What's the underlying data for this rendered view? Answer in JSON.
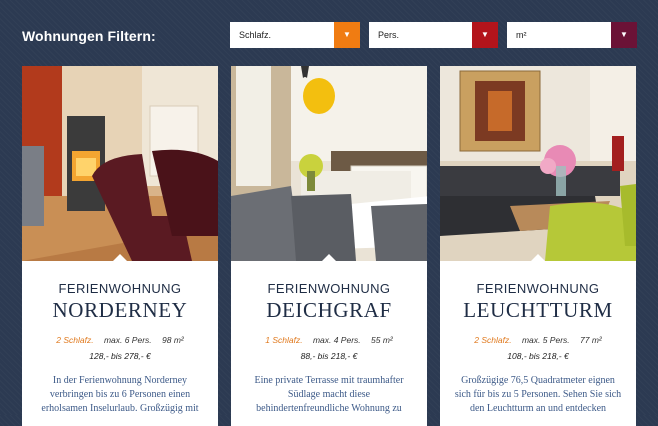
{
  "filter": {
    "title": "Wohnungen Filtern:",
    "selects": [
      {
        "label": "Schlafz.",
        "color": "#f07c12"
      },
      {
        "label": "Pers.",
        "color": "#b3141b"
      },
      {
        "label": "m²",
        "color": "#6b1236"
      }
    ],
    "arrow_icon": "chevron-down-icon"
  },
  "cards": [
    {
      "subtitle": "FERIENWOHNUNG",
      "name": "NORDERNEY",
      "beds": "2 Schlafz.",
      "persons": "max. 6 Pers.",
      "area": "98 m²",
      "price": "128,- bis 278,- €",
      "description": "In der Ferienwohnung Norderney verbringen bis zu 6 Personen einen erholsamen Inselurlaub. Großzügig mit"
    },
    {
      "subtitle": "FERIENWOHNUNG",
      "name": "DEICHGRAF",
      "beds": "1 Schlafz.",
      "persons": "max. 4 Pers.",
      "area": "55 m²",
      "price": "88,- bis 218,- €",
      "description": "Eine private Terrasse mit traumhafter Südlage macht diese behindertenfreundliche Wohnung zu"
    },
    {
      "subtitle": "FERIENWOHNUNG",
      "name": "LEUCHTTURM",
      "beds": "2 Schlafz.",
      "persons": "max. 5 Pers.",
      "area": "77 m²",
      "price": "108,- bis 218,- €",
      "description": "Großzügige 76,5 Quadratmeter eignen sich für bis zu 5 Personen. Sehen Sie sich den Leuchtturm an und entdecken"
    }
  ]
}
